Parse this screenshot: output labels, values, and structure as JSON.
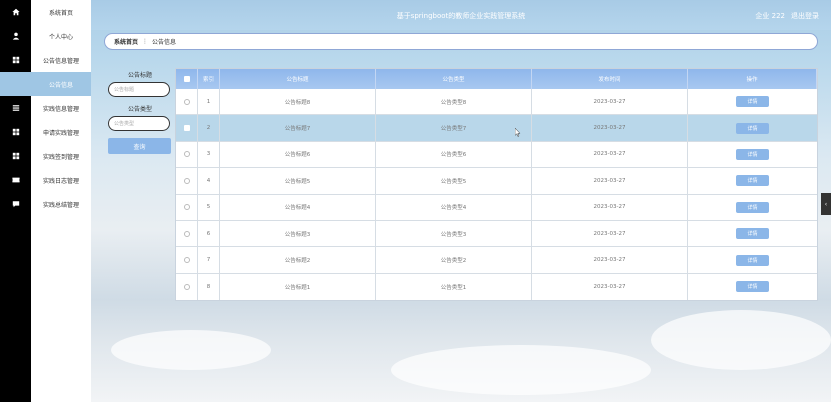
{
  "header": {
    "title": "基于springboot的教师企业实践管理系统",
    "user": "企业 222",
    "logout": "退出登录"
  },
  "sidebar": {
    "items": [
      {
        "label": "系统首页",
        "icon": "home-icon"
      },
      {
        "label": "个人中心",
        "icon": "user-icon"
      },
      {
        "label": "公告信息管理",
        "icon": "grid-icon"
      },
      {
        "label": "公告信息",
        "icon": "grid-icon",
        "active": true
      },
      {
        "label": "实践信息管理",
        "icon": "list-icon"
      },
      {
        "label": "申请实践管理",
        "icon": "grid-icon"
      },
      {
        "label": "实践签到管理",
        "icon": "grid-icon"
      },
      {
        "label": "实践日志管理",
        "icon": "ticket-icon"
      },
      {
        "label": "实践总结管理",
        "icon": "chat-icon"
      }
    ]
  },
  "breadcrumb": {
    "home": "系统首页",
    "separator": "⋮",
    "current": "公告信息"
  },
  "search": {
    "title_label": "公告标题",
    "title_placeholder": "公告标题",
    "type_label": "公告类型",
    "type_placeholder": "公告类型",
    "button": "查询"
  },
  "table": {
    "headers": {
      "index": "索引",
      "title": "公告标题",
      "type": "公告类型",
      "date": "发布时间",
      "op": "操作"
    },
    "rows": [
      {
        "index": "1",
        "title": "公告标题8",
        "type": "公告类型8",
        "date": "2023-03-27",
        "op": "详情"
      },
      {
        "index": "2",
        "title": "公告标题7",
        "type": "公告类型7",
        "date": "2023-03-27",
        "op": "详情",
        "selected": true
      },
      {
        "index": "3",
        "title": "公告标题6",
        "type": "公告类型6",
        "date": "2023-03-27",
        "op": "详情"
      },
      {
        "index": "4",
        "title": "公告标题5",
        "type": "公告类型5",
        "date": "2023-03-27",
        "op": "详情"
      },
      {
        "index": "5",
        "title": "公告标题4",
        "type": "公告类型4",
        "date": "2023-03-27",
        "op": "详情"
      },
      {
        "index": "6",
        "title": "公告标题3",
        "type": "公告类型3",
        "date": "2023-03-27",
        "op": "详情"
      },
      {
        "index": "7",
        "title": "公告标题2",
        "type": "公告类型2",
        "date": "2023-03-27",
        "op": "详情"
      },
      {
        "index": "8",
        "title": "公告标题1",
        "type": "公告类型1",
        "date": "2023-03-27",
        "op": "详情"
      }
    ]
  },
  "colors": {
    "accent": "#8bb6e8",
    "active": "#9fc6e4",
    "header": "#a8cbe6"
  }
}
